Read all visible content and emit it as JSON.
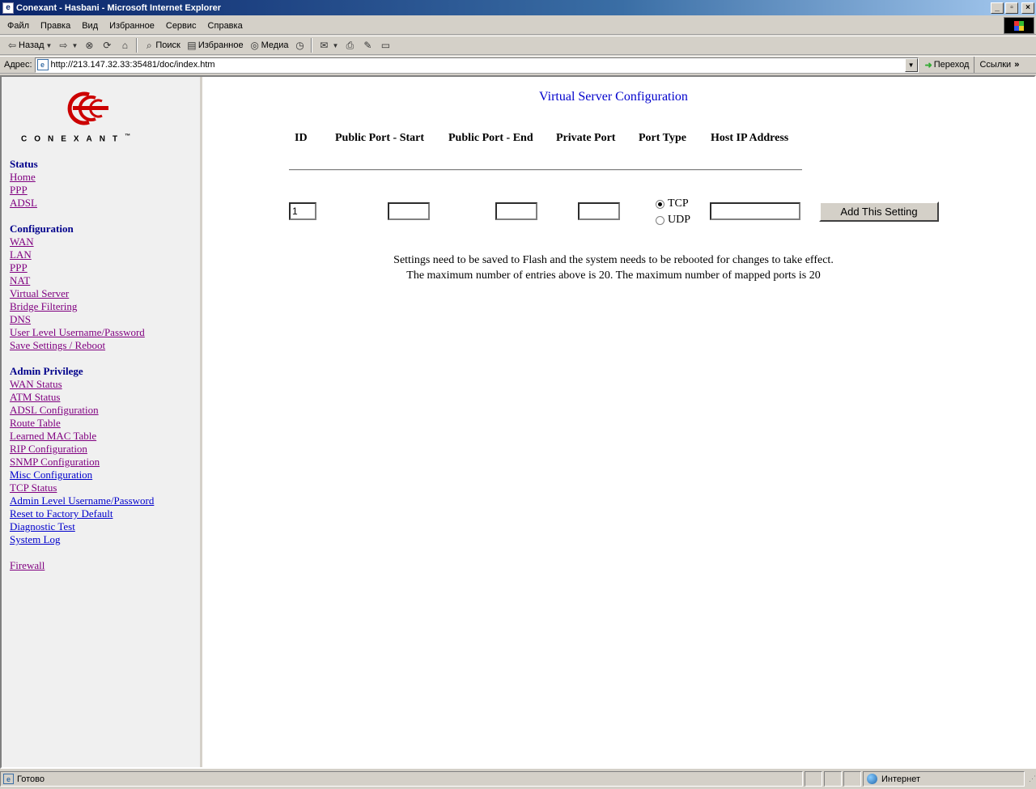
{
  "window": {
    "title": "Conexant - Hasbani - Microsoft Internet Explorer",
    "buttons": {
      "minimize": "_",
      "maximize": "▫",
      "close": "×"
    }
  },
  "menu": [
    "Файл",
    "Правка",
    "Вид",
    "Избранное",
    "Сервис",
    "Справка"
  ],
  "toolbar": {
    "back": "Назад",
    "search": "Поиск",
    "favorites": "Избранное",
    "media": "Медиа"
  },
  "address": {
    "label": "Адрес:",
    "url": "http://213.147.32.33:35481/doc/index.htm",
    "go": "Переход",
    "links": "Ссылки"
  },
  "sidebar": {
    "brand": "CONEXANT",
    "tm": "™",
    "sections": [
      {
        "heading": "Status",
        "links": [
          {
            "label": "Home",
            "visited": true
          },
          {
            "label": "PPP",
            "visited": true
          },
          {
            "label": "ADSL",
            "visited": true
          }
        ]
      },
      {
        "heading": "Configuration",
        "links": [
          {
            "label": "WAN",
            "visited": true
          },
          {
            "label": "LAN",
            "visited": true
          },
          {
            "label": "PPP",
            "visited": true
          },
          {
            "label": "NAT",
            "visited": true
          },
          {
            "label": "Virtual Server",
            "visited": true
          },
          {
            "label": "Bridge Filtering",
            "visited": true
          },
          {
            "label": "DNS",
            "visited": true
          },
          {
            "label": "User Level Username/Password",
            "visited": true
          },
          {
            "label": "Save Settings / Reboot",
            "visited": true
          }
        ]
      },
      {
        "heading": "Admin Privilege",
        "links": [
          {
            "label": "WAN Status",
            "visited": true
          },
          {
            "label": "ATM Status",
            "visited": true
          },
          {
            "label": "ADSL Configuration",
            "visited": true
          },
          {
            "label": "Route Table",
            "visited": true
          },
          {
            "label": "Learned MAC Table",
            "visited": true
          },
          {
            "label": "RIP Configuration",
            "visited": true
          },
          {
            "label": "SNMP Configuration",
            "visited": true
          },
          {
            "label": "Misc Configuration",
            "visited": false
          },
          {
            "label": "TCP Status",
            "visited": true
          },
          {
            "label": "Admin Level Username/Password",
            "visited": false
          },
          {
            "label": "Reset to Factory Default",
            "visited": false
          },
          {
            "label": "Diagnostic Test",
            "visited": false
          },
          {
            "label": "System Log",
            "visited": false
          }
        ]
      },
      {
        "heading": "",
        "links": [
          {
            "label": "Firewall",
            "visited": true
          }
        ]
      }
    ]
  },
  "main": {
    "title": "Virtual Server Configuration",
    "headers": {
      "id": "ID",
      "public_start": "Public Port - Start",
      "public_end": "Public Port - End",
      "private_port": "Private Port",
      "port_type": "Port Type",
      "host_ip": "Host IP Address"
    },
    "form": {
      "id_value": "1",
      "public_start_value": "",
      "public_end_value": "",
      "private_port_value": "",
      "host_ip_value": "",
      "port_type_options": [
        "TCP",
        "UDP"
      ],
      "port_type_selected": "TCP",
      "add_button": "Add This Setting"
    },
    "notes": [
      "Settings need to be saved to Flash and the system needs to be rebooted for changes to take effect.",
      "The maximum number of entries above is 20. The maximum number of mapped ports is 20"
    ]
  },
  "status": {
    "text": "Готово",
    "zone": "Интернет"
  },
  "colors": {
    "link": "#0000cc",
    "visited": "#800080",
    "heading": "#00008b",
    "logo_red": "#cc0000"
  }
}
